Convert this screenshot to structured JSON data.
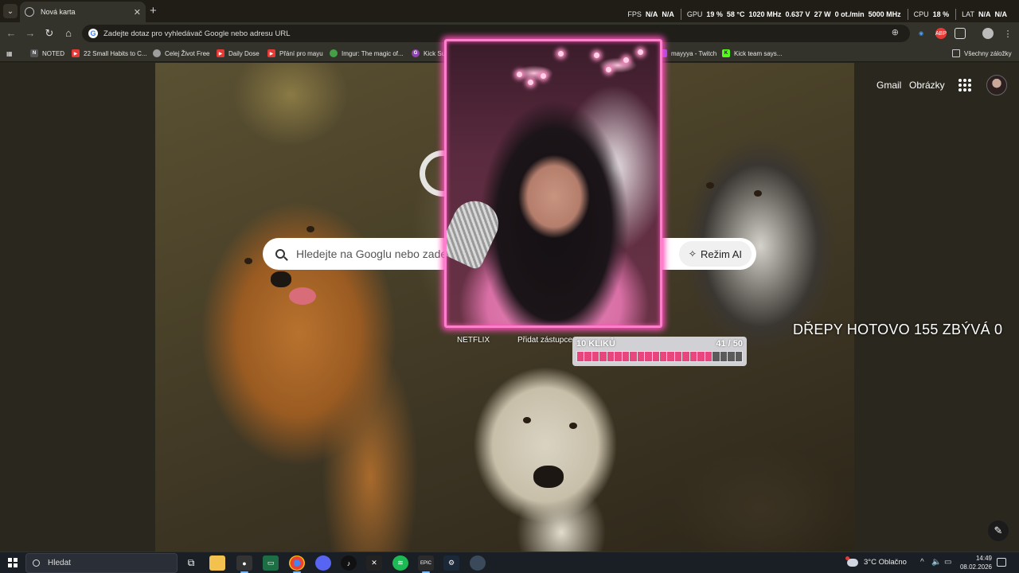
{
  "browser": {
    "tab_title": "Nová karta",
    "omnibox_placeholder": "Zadejte dotaz pro vyhledávač Google nebo adresu URL",
    "bookmarks": [
      {
        "label": "NOTED",
        "color": "#555555"
      },
      {
        "label": "22 Small Habits to C...",
        "color": "#e53935"
      },
      {
        "label": "Celej Život Free",
        "color": "#9e9e9e"
      },
      {
        "label": "Daily Dose",
        "color": "#e53935"
      },
      {
        "label": "Přání pro mayu",
        "color": "#e53935"
      },
      {
        "label": "Imgur: The magic of...",
        "color": "#43a047"
      },
      {
        "label": "Kick Su...",
        "color": "#8e44ad"
      },
      {
        "label": "mayyya - Twitch",
        "color": "#9146ff"
      },
      {
        "label": "Kick team says...",
        "color": "#53fc18"
      }
    ],
    "all_bookmarks": "Všechny záložky"
  },
  "perf_overlay": {
    "fps_label": "FPS",
    "fps_value1": "N/A",
    "fps_value2": "N/A",
    "gpu_label": "GPU",
    "gpu_load": "19 %",
    "gpu_temp": "58 °C",
    "gpu_clock": "1020 MHz",
    "gpu_voltage": "0.637 V",
    "gpu_power": "27 W",
    "gpu_fan": "0 ot./min",
    "gpu_mem_clock": "5000 MHz",
    "cpu_label": "CPU",
    "cpu_load": "18 %",
    "lat_label": "LAT",
    "lat_value1": "N/A",
    "lat_value2": "N/A"
  },
  "google": {
    "gmail": "Gmail",
    "images": "Obrázky",
    "search_placeholder": "Hledejte na Googlu nebo zadejte",
    "ai_mode": "Režim AI",
    "shortcuts": [
      "NETFLIX",
      "Přidat zástupce"
    ]
  },
  "stream_overlay": {
    "squats_text": "DŘEPY HOTOVO 155 ZBÝVÁ 0",
    "clicks_label": "10 KLIKŮ",
    "clicks_count": "41 / 50",
    "clicks_done": 41,
    "clicks_total": 50,
    "clicks_segments": 22,
    "accent_color": "#ff4fb8"
  },
  "taskbar": {
    "search_label": "Hledat",
    "weather": "3°C  Oblačno",
    "time": "14:49",
    "date": "08.02.2026"
  }
}
